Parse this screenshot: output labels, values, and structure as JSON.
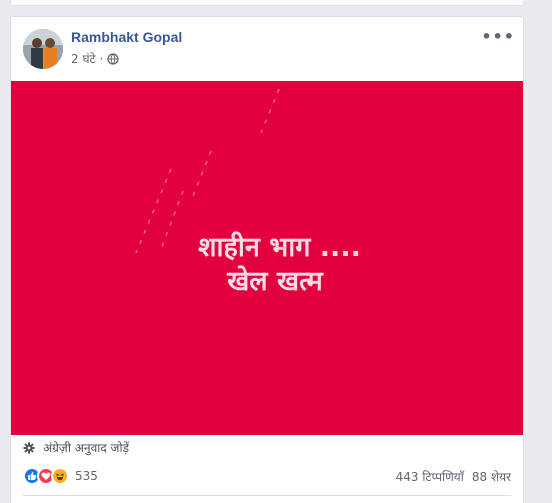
{
  "post": {
    "author": "Rambhakt Gopal",
    "time": "2 घंटे",
    "more_label": "•••",
    "image_text": {
      "line1": "शाहीन भाग ....",
      "line2": "खेल खत्म"
    },
    "translate_label": "अंग्रेज़ी अनुवाद जोड़ें",
    "reaction_count": "535",
    "comments_label": "443 टिप्पणियाँ",
    "shares_label": "88 शेयर",
    "icons": {
      "privacy": "globe-icon",
      "translate": "gear-icon",
      "reactions": [
        "like-icon",
        "love-icon",
        "haha-icon"
      ]
    },
    "colors": {
      "image_bg": "#e3003e",
      "image_text": "#f6dbe2",
      "author": "#385898",
      "like": "#1877f2",
      "love": "#f33e58",
      "haha": "#f7b125"
    }
  }
}
